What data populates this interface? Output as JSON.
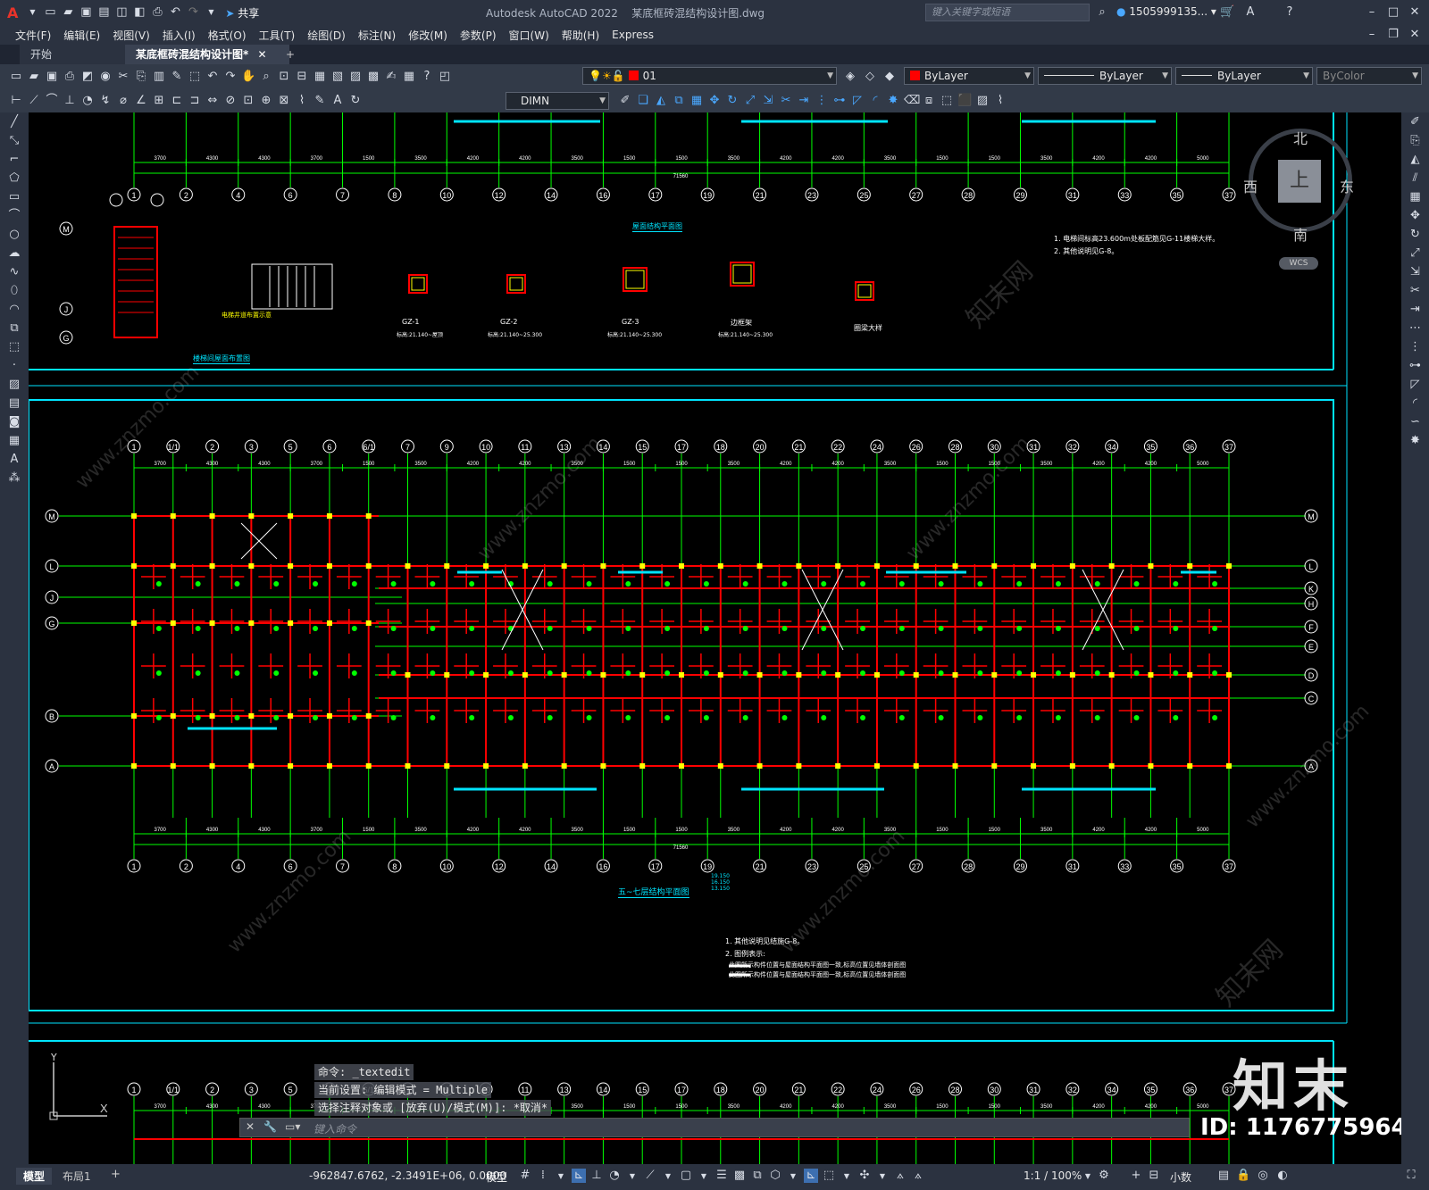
{
  "app": {
    "title": "Autodesk AutoCAD 2022",
    "file": "某底框砖混结构设计图.dwg",
    "search_placeholder": "键入关键字或短语",
    "user": "1505999135...",
    "share_label": "共享"
  },
  "menu": [
    "文件(F)",
    "编辑(E)",
    "视图(V)",
    "插入(I)",
    "格式(O)",
    "工具(T)",
    "绘图(D)",
    "标注(N)",
    "修改(M)",
    "参数(P)",
    "窗口(W)",
    "帮助(H)",
    "Express"
  ],
  "tabs": {
    "start": "开始",
    "doc": "某底框砖混结构设计图*",
    "add": "+"
  },
  "toolbar": {
    "layer": "01",
    "color": "ByLayer",
    "linetype": "ByLayer",
    "lineweight": "ByLayer",
    "plotstyle": "ByColor",
    "dimstyle": "DIMN"
  },
  "viewcube": {
    "north": "北",
    "south": "南",
    "east": "东",
    "west": "西",
    "face": "上",
    "wcs": "WCS"
  },
  "drawing": {
    "top_labels": [
      "屋面结构平面图",
      "楼梯间屋面布置图",
      "电梯井道布置示意"
    ],
    "gz_labels": [
      "GZ-1",
      "GZ-2",
      "GZ-3",
      "边框架",
      "圈梁大样"
    ],
    "gz_notes": [
      "标高:21.140~屋顶",
      "标高:21.140~25.300",
      "标高:21.140~25.300",
      "标高:21.140~25.300"
    ],
    "note_top": [
      "1. 电梯间标高23.600m处板配筋见G-11楼梯大样。",
      "2. 其他说明见G-8。"
    ],
    "main_title": "五~七层结构平面图",
    "main_elev": [
      "19.150",
      "16.150",
      "13.150"
    ],
    "notes_main": [
      "1. 其他说明见结施G-8。",
      "2. 图例表示:",
      "此图所示构件位置与屋面结构平面图一致,标高位置见墙体剖面图",
      "此图所示构件位置与屋面结构平面图一致,标高位置见墙体剖面图"
    ],
    "axis_top": [
      "1",
      "2",
      "4",
      "6",
      "7",
      "8",
      "10",
      "12",
      "14",
      "16",
      "17",
      "19",
      "21",
      "23",
      "25",
      "27",
      "28",
      "29",
      "31",
      "33",
      "35",
      "37"
    ],
    "axis_mid": [
      "1",
      "1/1",
      "2",
      "3",
      "5",
      "6",
      "6/1",
      "7",
      "9",
      "10",
      "11",
      "13",
      "14",
      "15",
      "17",
      "18",
      "20",
      "21",
      "22",
      "24",
      "26",
      "28",
      "30",
      "31",
      "32",
      "34",
      "35",
      "36",
      "37"
    ],
    "axis_rows_left": [
      "M",
      "L",
      "J",
      "G",
      "B",
      "A"
    ],
    "axis_rows_right": [
      "M",
      "L",
      "K",
      "H",
      "F",
      "E",
      "D",
      "C",
      "A"
    ],
    "dims_bottom": [
      "3700",
      "4300",
      "4300",
      "3700",
      "1500",
      "3500",
      "4200",
      "4200",
      "3500",
      "1500",
      "1500",
      "3500",
      "4200",
      "4200",
      "3500",
      "1500",
      "1500",
      "3500",
      "4200",
      "4200",
      "5000"
    ],
    "total_dim": "71560"
  },
  "command": {
    "line1": "命令: _textedit",
    "line2": "当前设置: 编辑模式 = Multiple",
    "line3": "选择注释对象或 [放弃(U)/模式(M)]: *取消*",
    "input_placeholder": "键入命令"
  },
  "status": {
    "model_tab": "模型",
    "layout_tab": "布局1",
    "add": "+",
    "coords": "-962847.6762, -2.3491E+06, 0.0000",
    "mode": "模型",
    "scale": "1:1 / 100%",
    "units": "小数"
  },
  "watermark": {
    "brand": "知末",
    "id": "ID: 1176775964",
    "site": "www.znzmo.com",
    "site_cn": "知末网"
  },
  "colors": {
    "bg": "#000000",
    "frame": "#00e5ff",
    "grid_green": "#00ff00",
    "beam_red": "#ff0000",
    "column_yellow": "#ffff00",
    "ui": "#2b3240"
  }
}
